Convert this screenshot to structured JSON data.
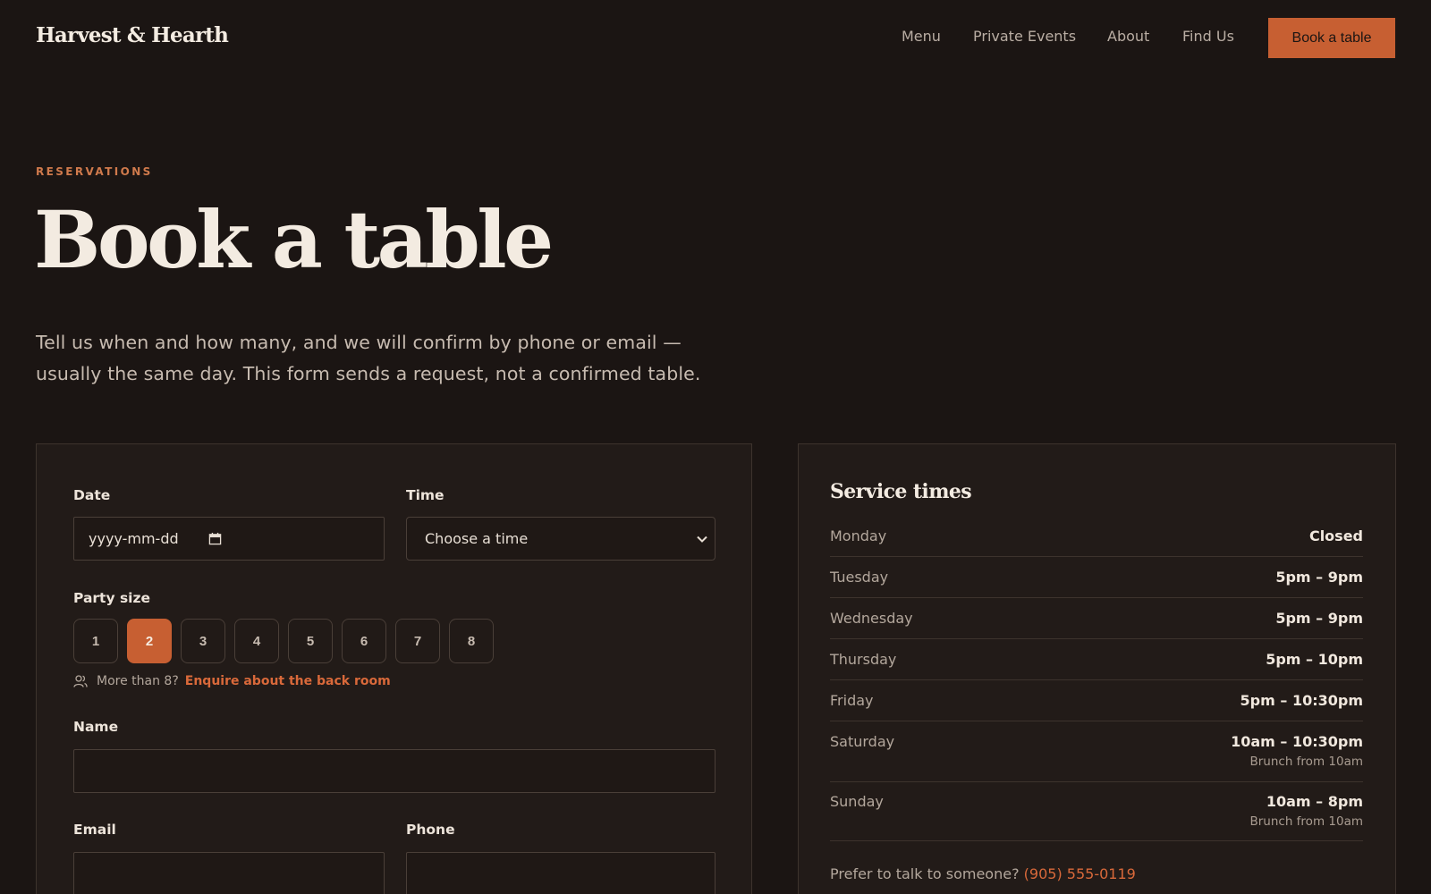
{
  "header": {
    "logo": "Harvest & Hearth",
    "nav": [
      "Menu",
      "Private Events",
      "About",
      "Find Us"
    ],
    "cta": "Book a table"
  },
  "hero": {
    "eyebrow": "RESERVATIONS",
    "title": "Book a table",
    "intro_line1": "Tell us when and how many, and we will confirm by phone or email —",
    "intro_line2": "usually the same day. This form sends a request, not a confirmed table."
  },
  "form": {
    "date_label": "Date",
    "date_placeholder": "yyyy-mm-dd",
    "time_label": "Time",
    "time_value": "Choose a time",
    "party_label": "Party size",
    "party_options": [
      "1",
      "2",
      "3",
      "4",
      "5",
      "6",
      "7",
      "8"
    ],
    "party_selected": "2",
    "more_text": "More than 8?",
    "more_link": "Enquire about the back room",
    "name_label": "Name",
    "email_label": "Email",
    "phone_label": "Phone"
  },
  "service": {
    "title": "Service times",
    "rows": [
      {
        "day": "Monday",
        "time": "Closed",
        "note": ""
      },
      {
        "day": "Tuesday",
        "time": "5pm – 9pm",
        "note": ""
      },
      {
        "day": "Wednesday",
        "time": "5pm – 9pm",
        "note": ""
      },
      {
        "day": "Thursday",
        "time": "5pm – 10pm",
        "note": ""
      },
      {
        "day": "Friday",
        "time": "5pm – 10:30pm",
        "note": ""
      },
      {
        "day": "Saturday",
        "time": "10am – 10:30pm",
        "note": "Brunch from 10am"
      },
      {
        "day": "Sunday",
        "time": "10am – 8pm",
        "note": "Brunch from 10am"
      }
    ],
    "talk_text": "Prefer to talk to someone?",
    "talk_phone": "(905) 555-0119"
  },
  "colors": {
    "background": "#1b1513",
    "card": "#221b18",
    "accent": "#c75f32",
    "link": "#d9693a"
  },
  "icons": [
    "calendar-icon",
    "chevron-down-icon",
    "people-icon"
  ]
}
